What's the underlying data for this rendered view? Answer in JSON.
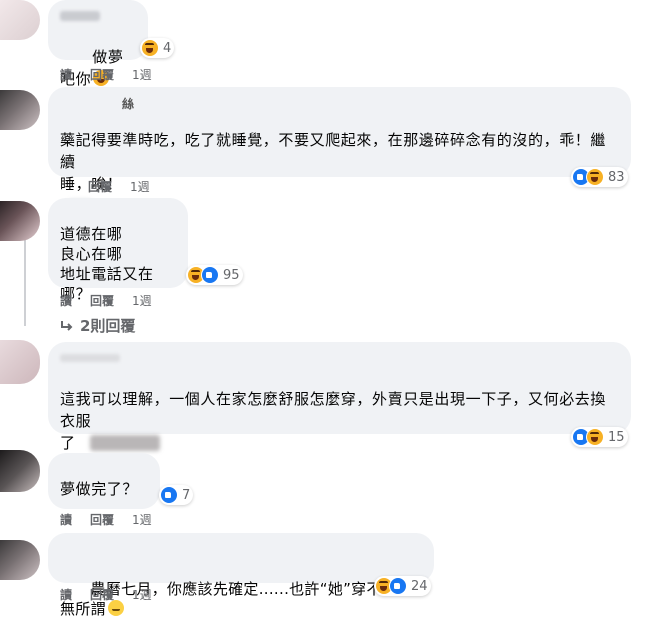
{
  "actions": {
    "reply_short": "讀",
    "reply": "回覆"
  },
  "comments": [
    {
      "name": "",
      "text": "做夢吧你",
      "reaction_count": "4",
      "time": "1週"
    },
    {
      "name": "絲",
      "text": "藥記得要準時吃，吃了就睡覺，不要又爬起來，在那邊碎碎念有的沒的，乖！繼續\n睡，唉！",
      "reaction_count": "83",
      "time": "1週"
    },
    {
      "name": "",
      "text": "道德在哪\n良心在哪\n地址電話又在哪？",
      "reaction_count": "95",
      "time": "1週",
      "view_replies": "2則回覆"
    },
    {
      "name": "",
      "text": "這我可以理解，一個人在家怎麼舒服怎麼穿，外賣只是出現一下子，又何必去換衣服\n了",
      "reaction_count": "15",
      "time": ""
    },
    {
      "name": "",
      "text": "夢做完了？",
      "reaction_count": "7",
      "time": "1週"
    },
    {
      "name": "",
      "text": "農曆七月，你應該先確定......也許“她”穿不穿都無所謂",
      "reaction_count": "24",
      "time": "1週"
    }
  ],
  "icons": [
    "like-icon",
    "haha-icon",
    "reply-arrow-icon"
  ],
  "colors": {
    "bubble": "#f0f2f5",
    "like": "#1877f2",
    "haha": "#f7b125",
    "meta": "#65676b"
  }
}
